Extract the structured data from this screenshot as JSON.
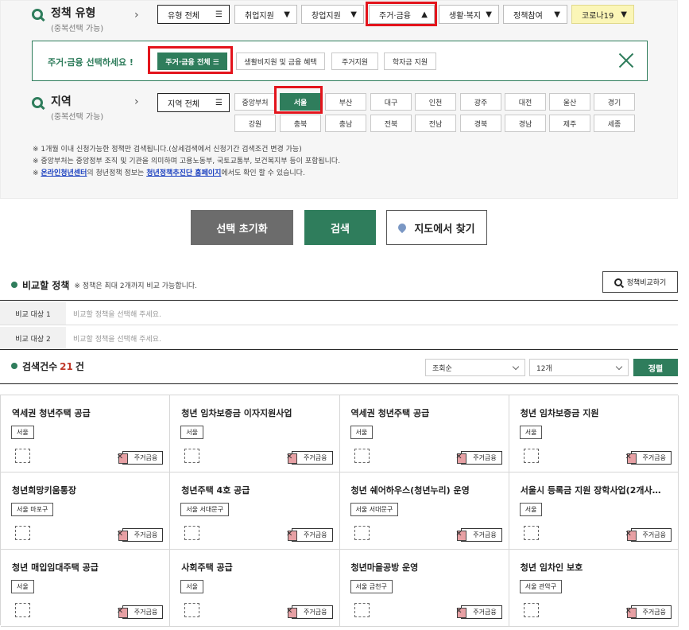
{
  "policy_type": {
    "title": "정책 유형",
    "subtitle": "(중복선택 가능)",
    "dropdowns": [
      {
        "label": "유형 전체",
        "icon": "menu-icon"
      },
      {
        "label": "취업지원",
        "icon": "caret-down-icon"
      },
      {
        "label": "창업지원",
        "icon": "caret-down-icon"
      },
      {
        "label": "주거·금융",
        "icon": "caret-up-icon"
      },
      {
        "label": "생활·복지",
        "icon": "caret-down-icon"
      },
      {
        "label": "정책참여",
        "icon": "caret-down-icon"
      },
      {
        "label": "코로나19",
        "icon": "caret-down-icon"
      }
    ]
  },
  "housing": {
    "prompt": "주거·금융 선택하세요 !",
    "chips": [
      "주거·금융 전체 ☰",
      "생활비지원 및 금융 혜택",
      "주거지원",
      "학자금 지원"
    ]
  },
  "region": {
    "title": "지역",
    "subtitle": "(중복선택 가능)",
    "dropdown": "지역 전체",
    "row1": [
      "중앙부처",
      "서울",
      "부산",
      "대구",
      "인천",
      "광주",
      "대전",
      "울산",
      "경기"
    ],
    "row2": [
      "강원",
      "충북",
      "충남",
      "전북",
      "전남",
      "경북",
      "경남",
      "제주",
      "세종"
    ]
  },
  "notes": {
    "line1": "※ 1개월 이내 신청가능한 정책만 검색됩니다.(상세검색에서 신청기간 검색조건 변경 가능)",
    "line2": "※ 중앙부처는 중앙정부 조직 및 기관을 의미하며 고용노동부, 국토교통부, 보건복지부 등이 포함됩니다.",
    "line3_prefix": "※ ",
    "line3_link1": "온라인청년센터",
    "line3_mid": "의 청년정책 정보는 ",
    "line3_link2": "청년정책추진단 홈페이지",
    "line3_suffix": "에서도 확인 할 수 있습니다."
  },
  "buttons": {
    "reset": "선택 초기화",
    "search": "검색",
    "map": "지도에서 찾기"
  },
  "compare": {
    "title": "비교할 정책",
    "note": "※ 정책은 최대 2개까지 비교 가능합니다.",
    "button": "정책비교하기",
    "rows": [
      {
        "label": "비교 대상 1",
        "placeholder": "비교할 정책을 선택해 주세요."
      },
      {
        "label": "비교 대상 2",
        "placeholder": "비교할 정책을 선택해 주세요."
      }
    ]
  },
  "results": {
    "label": "검색건수",
    "count": "21",
    "unit": "건",
    "sort_select": "조회순",
    "per_page_select": "12개",
    "sort_button": "정렬"
  },
  "cards": [
    {
      "title": "역세권 청년주택 공급",
      "region": "서울",
      "tag": "주거금융"
    },
    {
      "title": "청년 임차보증금 이자지원사업",
      "region": "서울",
      "tag": "주거금융"
    },
    {
      "title": "역세권 청년주택 공급",
      "region": "서울",
      "tag": "주거금융"
    },
    {
      "title": "청년 임차보증금 지원",
      "region": "서울",
      "tag": "주거금융"
    },
    {
      "title": "청년희망키움통장",
      "region": "서울 마포구",
      "tag": "주거금융"
    },
    {
      "title": "청년주택 4호 공급",
      "region": "서울 서대문구",
      "tag": "주거금융"
    },
    {
      "title": "청년 쉐어하우스(청년누리) 운영",
      "region": "서울 서대문구",
      "tag": "주거금융"
    },
    {
      "title": "서울시 등록금 지원 장학사업(2개사…",
      "region": "서울",
      "tag": "주거금융"
    },
    {
      "title": "청년 매입임대주택 공급",
      "region": "서울",
      "tag": "주거금융"
    },
    {
      "title": "사회주택 공급",
      "region": "서울",
      "tag": "주거금융"
    },
    {
      "title": "청년마을공방 운영",
      "region": "서울 금천구",
      "tag": "주거금융"
    },
    {
      "title": "청년 임차인 보호",
      "region": "서울 관악구",
      "tag": "주거금융"
    }
  ]
}
